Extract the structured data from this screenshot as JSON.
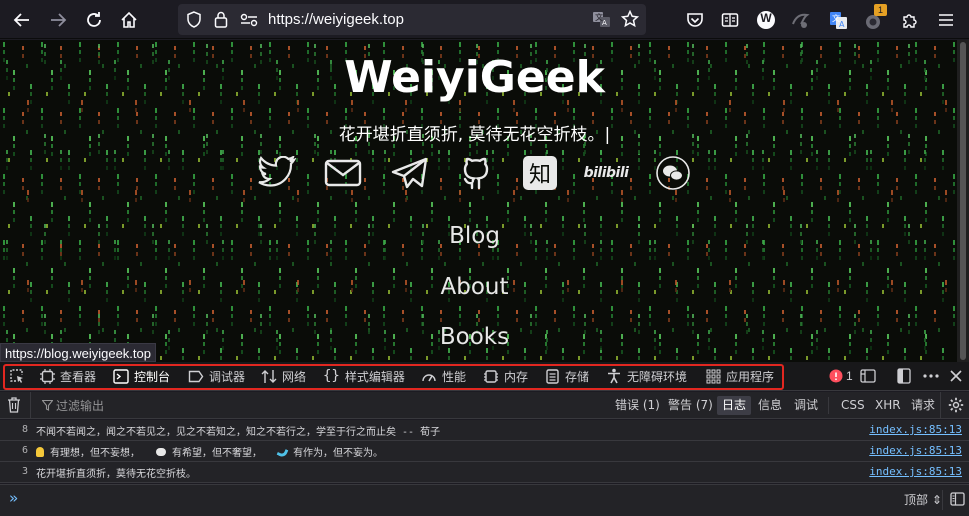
{
  "browser": {
    "url": "https://weiyigeek.top",
    "notification_badge": "1",
    "extension_w_label": "W"
  },
  "page": {
    "title": "WeiyiGeek",
    "subtitle": "花开堪折直须折, 莫待无花空折枝。|",
    "zhihu_label": "知",
    "bilibili_label": "bilibili",
    "menu": [
      "Blog",
      "About",
      "Books"
    ],
    "hover_link": "https://blog.weiyigeek.top"
  },
  "devtools": {
    "tabs": [
      {
        "label": "查看器",
        "icon": "inspector-icon"
      },
      {
        "label": "控制台",
        "icon": "console-icon"
      },
      {
        "label": "调试器",
        "icon": "debugger-icon"
      },
      {
        "label": "网络",
        "icon": "network-icon"
      },
      {
        "label": "样式编辑器",
        "icon": "style-editor-icon"
      },
      {
        "label": "性能",
        "icon": "performance-icon"
      },
      {
        "label": "内存",
        "icon": "memory-icon"
      },
      {
        "label": "存储",
        "icon": "storage-icon"
      },
      {
        "label": "无障碍环境",
        "icon": "accessibility-icon"
      },
      {
        "label": "应用程序",
        "icon": "application-icon"
      }
    ],
    "selected_tab": "控制台",
    "error_count": "1",
    "filter_placeholder": "过滤输出",
    "levels": {
      "errors": "错误 (1)",
      "warnings": "警告 (7)",
      "logs": "日志",
      "info": "信息",
      "debug": "调试",
      "css": "CSS",
      "xhr": "XHR",
      "requests": "请求"
    },
    "messages": [
      {
        "count": "8",
        "parts": [
          "不闻不若闻之，闻之不若见之，见之不若知之，知之不若行之，学至于行之而止矣 -- 荀子"
        ],
        "source": "index.js:85:13"
      },
      {
        "count": "6",
        "parts": [
          "有理想，但不妄想，",
          "有希望，但不奢望，",
          "有作为，但不妄为。"
        ],
        "source": "index.js:85:13"
      },
      {
        "count": "3",
        "parts": [
          "花开堪折直须折，莫待无花空折枝。"
        ],
        "source": "index.js:85:13"
      }
    ],
    "context_selector": "顶部 ⇕"
  },
  "colors": {
    "accent_red": "#e22720",
    "link_blue": "#75bfff",
    "matrix_green": "#3fa84a"
  }
}
